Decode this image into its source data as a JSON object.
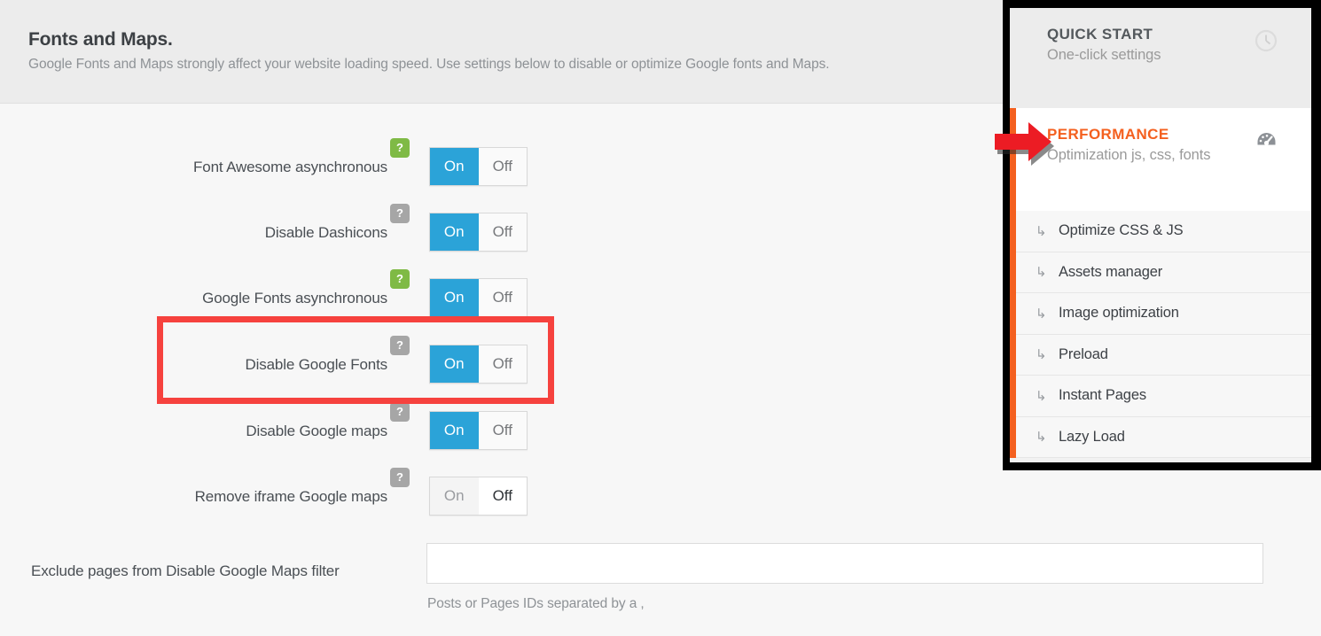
{
  "section": {
    "title": "Fonts and Maps.",
    "subtitle": "Google Fonts and Maps strongly affect your website loading speed. Use settings below to disable or optimize Google fonts and Maps."
  },
  "toggle_labels": {
    "on": "On",
    "off": "Off"
  },
  "help_icon_glyph": "?",
  "colors": {
    "toggle_on": "#2ba3d8",
    "help_green": "#7fba45",
    "help_gray": "#a6a6a6",
    "highlight_red": "#f6423e",
    "accent_orange": "#f4601f",
    "header_bg": "#ececec",
    "body_bg": "#f7f7f7"
  },
  "settings": [
    {
      "label": "Font Awesome asynchronous",
      "state": "on",
      "help_color": "green",
      "highlighted": false
    },
    {
      "label": "Disable Dashicons",
      "state": "on",
      "help_color": "gray",
      "highlighted": false
    },
    {
      "label": "Google Fonts asynchronous",
      "state": "on",
      "help_color": "green",
      "highlighted": false
    },
    {
      "label": "Disable Google Fonts",
      "state": "on",
      "help_color": "gray",
      "highlighted": true
    },
    {
      "label": "Disable Google maps",
      "state": "on",
      "help_color": "gray",
      "highlighted": false
    },
    {
      "label": "Remove iframe Google maps",
      "state": "off",
      "help_color": "gray",
      "highlighted": false
    }
  ],
  "exclude_field": {
    "label": "Exclude pages from Disable Google Maps filter",
    "value": "",
    "placeholder": "",
    "hint": "Posts or Pages IDs separated by a ,"
  },
  "nav_panel": {
    "quick_start": {
      "title": "QUICK START",
      "subtitle": "One-click settings",
      "icon": "clock-icon"
    },
    "performance": {
      "title": "PERFORMANCE",
      "subtitle": "Optimization js, css, fonts",
      "icon": "gauge-icon",
      "active": true
    },
    "sub_items": [
      {
        "label": "Optimize CSS & JS",
        "arrow": "↳"
      },
      {
        "label": "Assets manager",
        "arrow": "↳"
      },
      {
        "label": "Image optimization",
        "arrow": "↳"
      },
      {
        "label": "Preload",
        "arrow": "↳"
      },
      {
        "label": "Instant Pages",
        "arrow": "↳"
      },
      {
        "label": "Lazy Load",
        "arrow": "↳"
      }
    ]
  },
  "annotations": {
    "pointer_arrow": "red-arrow-pointing-to-performance",
    "highlight_target": "Disable Google Fonts"
  }
}
